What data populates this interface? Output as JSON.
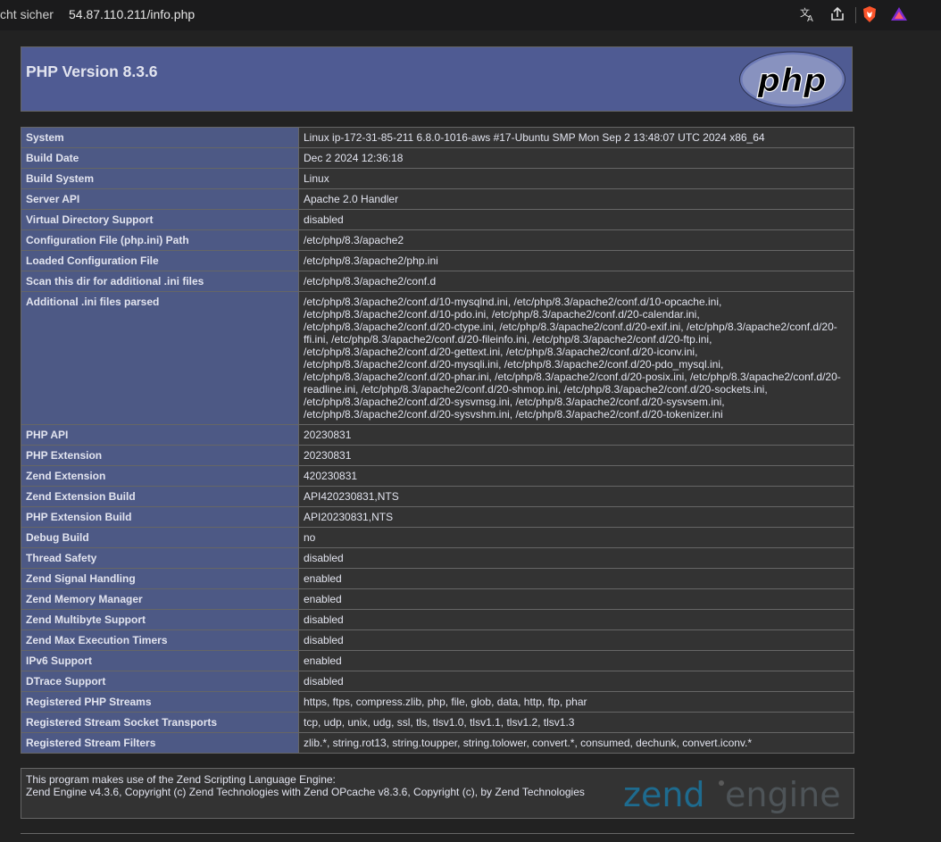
{
  "browser": {
    "insecure_label": "cht sicher",
    "url": "54.87.110.211/info.php"
  },
  "header": {
    "title": "PHP Version 8.3.6",
    "logo_text": "php"
  },
  "rows": [
    {
      "key": "System",
      "value": "Linux ip-172-31-85-211 6.8.0-1016-aws #17-Ubuntu SMP Mon Sep 2 13:48:07 UTC 2024 x86_64"
    },
    {
      "key": "Build Date",
      "value": "Dec 2 2024 12:36:18"
    },
    {
      "key": "Build System",
      "value": "Linux"
    },
    {
      "key": "Server API",
      "value": "Apache 2.0 Handler"
    },
    {
      "key": "Virtual Directory Support",
      "value": "disabled"
    },
    {
      "key": "Configuration File (php.ini) Path",
      "value": "/etc/php/8.3/apache2"
    },
    {
      "key": "Loaded Configuration File",
      "value": "/etc/php/8.3/apache2/php.ini"
    },
    {
      "key": "Scan this dir for additional .ini files",
      "value": "/etc/php/8.3/apache2/conf.d"
    },
    {
      "key": "Additional .ini files parsed",
      "value": "/etc/php/8.3/apache2/conf.d/10-mysqlnd.ini, /etc/php/8.3/apache2/conf.d/10-opcache.ini, /etc/php/8.3/apache2/conf.d/10-pdo.ini, /etc/php/8.3/apache2/conf.d/20-calendar.ini, /etc/php/8.3/apache2/conf.d/20-ctype.ini, /etc/php/8.3/apache2/conf.d/20-exif.ini, /etc/php/8.3/apache2/conf.d/20-ffi.ini, /etc/php/8.3/apache2/conf.d/20-fileinfo.ini, /etc/php/8.3/apache2/conf.d/20-ftp.ini, /etc/php/8.3/apache2/conf.d/20-gettext.ini, /etc/php/8.3/apache2/conf.d/20-iconv.ini, /etc/php/8.3/apache2/conf.d/20-mysqli.ini, /etc/php/8.3/apache2/conf.d/20-pdo_mysql.ini, /etc/php/8.3/apache2/conf.d/20-phar.ini, /etc/php/8.3/apache2/conf.d/20-posix.ini, /etc/php/8.3/apache2/conf.d/20-readline.ini, /etc/php/8.3/apache2/conf.d/20-shmop.ini, /etc/php/8.3/apache2/conf.d/20-sockets.ini, /etc/php/8.3/apache2/conf.d/20-sysvmsg.ini, /etc/php/8.3/apache2/conf.d/20-sysvsem.ini, /etc/php/8.3/apache2/conf.d/20-sysvshm.ini, /etc/php/8.3/apache2/conf.d/20-tokenizer.ini"
    },
    {
      "key": "PHP API",
      "value": "20230831"
    },
    {
      "key": "PHP Extension",
      "value": "20230831"
    },
    {
      "key": "Zend Extension",
      "value": "420230831"
    },
    {
      "key": "Zend Extension Build",
      "value": "API420230831,NTS"
    },
    {
      "key": "PHP Extension Build",
      "value": "API20230831,NTS"
    },
    {
      "key": "Debug Build",
      "value": "no"
    },
    {
      "key": "Thread Safety",
      "value": "disabled"
    },
    {
      "key": "Zend Signal Handling",
      "value": "enabled"
    },
    {
      "key": "Zend Memory Manager",
      "value": "enabled"
    },
    {
      "key": "Zend Multibyte Support",
      "value": "disabled"
    },
    {
      "key": "Zend Max Execution Timers",
      "value": "disabled"
    },
    {
      "key": "IPv6 Support",
      "value": "enabled"
    },
    {
      "key": "DTrace Support",
      "value": "disabled"
    },
    {
      "key": "Registered PHP Streams",
      "value": "https, ftps, compress.zlib, php, file, glob, data, http, ftp, phar"
    },
    {
      "key": "Registered Stream Socket Transports",
      "value": "tcp, udp, unix, udg, ssl, tls, tlsv1.0, tlsv1.1, tlsv1.2, tlsv1.3"
    },
    {
      "key": "Registered Stream Filters",
      "value": "zlib.*, string.rot13, string.toupper, string.tolower, convert.*, consumed, dechunk, convert.iconv.*"
    }
  ],
  "footer": {
    "line1": "This program makes use of the Zend Scripting Language Engine:",
    "line2": "Zend Engine v4.3.6, Copyright (c) Zend Technologies with Zend OPcache v8.3.6, Copyright (c), by Zend Technologies",
    "logo_text_zend": "zend",
    "logo_text_engine": "engine"
  },
  "colors": {
    "header_bg": "#4f5b93",
    "key_bg": "#4d5985",
    "value_bg": "#333333",
    "page_bg": "#222222"
  }
}
